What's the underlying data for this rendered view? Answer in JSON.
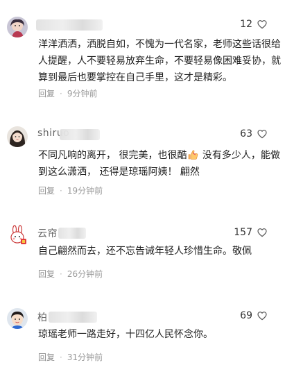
{
  "comments": [
    {
      "username": "",
      "likes": "12",
      "text": "洋洋洒洒，洒脱自如，不愧为一代名家，老师这些话很给人提醒，人不要轻易放弃生命，不要轻易像困难妥协，就算到最后也要掌控在自己手里，这才是精彩。",
      "reply_label": "回复",
      "dot": "·",
      "time": "9分钟前"
    },
    {
      "username": "shiruo",
      "likes": "63",
      "text_part1": "不同凡响的离开，  很完美，也很酷",
      "emoji": "thumbs-up",
      "text_part2": " 没有多少人，能做到这么潇洒，  还得是琼瑶阿姨！  翩然",
      "reply_label": "回复",
      "dot": "·",
      "time": "19分钟前"
    },
    {
      "username": "云帘",
      "likes": "157",
      "text": "自己翩然而去，还不忘告诫年轻人珍惜生命。敬佩",
      "reply_label": "回复",
      "dot": "·",
      "time": "26分钟前"
    },
    {
      "username": "柏",
      "likes": "69",
      "text": "琼瑶老师一路走好，十四亿人民怀念你。",
      "reply_label": "回复",
      "dot": "·",
      "time": "31分钟前"
    }
  ],
  "icons": {
    "like": "heart-outline-icon",
    "avatar_1": "girl-avatar",
    "avatar_2": "woman-avatar",
    "avatar_3": "rabbit-avatar",
    "avatar_4": "child-avatar"
  },
  "colors": {
    "meta_text": "#9a9a9a",
    "body_text": "#1f1f1f",
    "username_text": "#666666"
  }
}
